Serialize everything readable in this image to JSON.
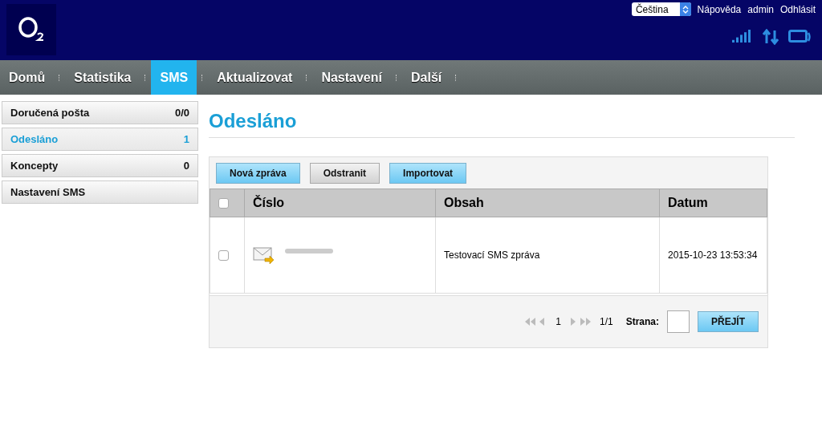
{
  "header": {
    "language": "Čeština",
    "links": [
      "Nápověda",
      "admin",
      "Odhlásit"
    ]
  },
  "nav": [
    {
      "label": "Domů",
      "selected": false
    },
    {
      "label": "Statistika",
      "selected": false
    },
    {
      "label": "SMS",
      "selected": true
    },
    {
      "label": "Aktualizovat",
      "selected": false
    },
    {
      "label": "Nastavení",
      "selected": false
    },
    {
      "label": "Další",
      "selected": false
    }
  ],
  "sidebar": [
    {
      "label": "Doručená pošta",
      "count": "0/0",
      "selected": false
    },
    {
      "label": "Odesláno",
      "count": "1",
      "selected": true
    },
    {
      "label": "Koncepty",
      "count": "0",
      "selected": false
    },
    {
      "label": "Nastavení SMS",
      "selected": false
    }
  ],
  "page_title": "Odesláno",
  "toolbar": [
    {
      "label": "Nová zpráva",
      "kind": "primary"
    },
    {
      "label": "Odstranit",
      "kind": "secondary"
    },
    {
      "label": "Importovat",
      "kind": "primary"
    }
  ],
  "table": {
    "select_all": false,
    "columns": [
      "Číslo",
      "Obsah",
      "Datum"
    ],
    "rows": [
      {
        "checked": false,
        "content": "Testovací SMS zpráva",
        "date": "2015-10-23 13:53:34"
      }
    ]
  },
  "pagination": {
    "page": "1",
    "total": "1/1",
    "goto_label": "Strana:",
    "button": "PŘEJÍT"
  }
}
